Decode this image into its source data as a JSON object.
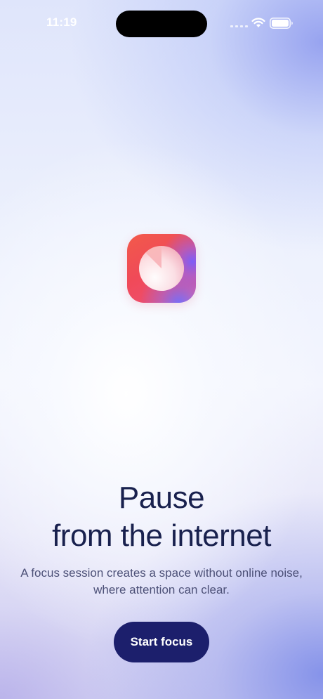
{
  "status_bar": {
    "time": "11:19",
    "icons": [
      "cellular-signal-icon",
      "wifi-icon",
      "battery-icon"
    ]
  },
  "app": {
    "icon": "focus-dial-icon",
    "colors": {
      "icon_primary": "#f04a58",
      "icon_accent": "#7a5cff",
      "text_dark": "#19214e",
      "text_muted": "#4d5178",
      "button": "#1c1f6c"
    }
  },
  "onboarding": {
    "headline_line1": "Pause",
    "headline_line2": "from the internet",
    "subtitle": "A focus session creates a space without online noise, where attention can clear."
  },
  "actions": {
    "start_label": "Start focus"
  }
}
